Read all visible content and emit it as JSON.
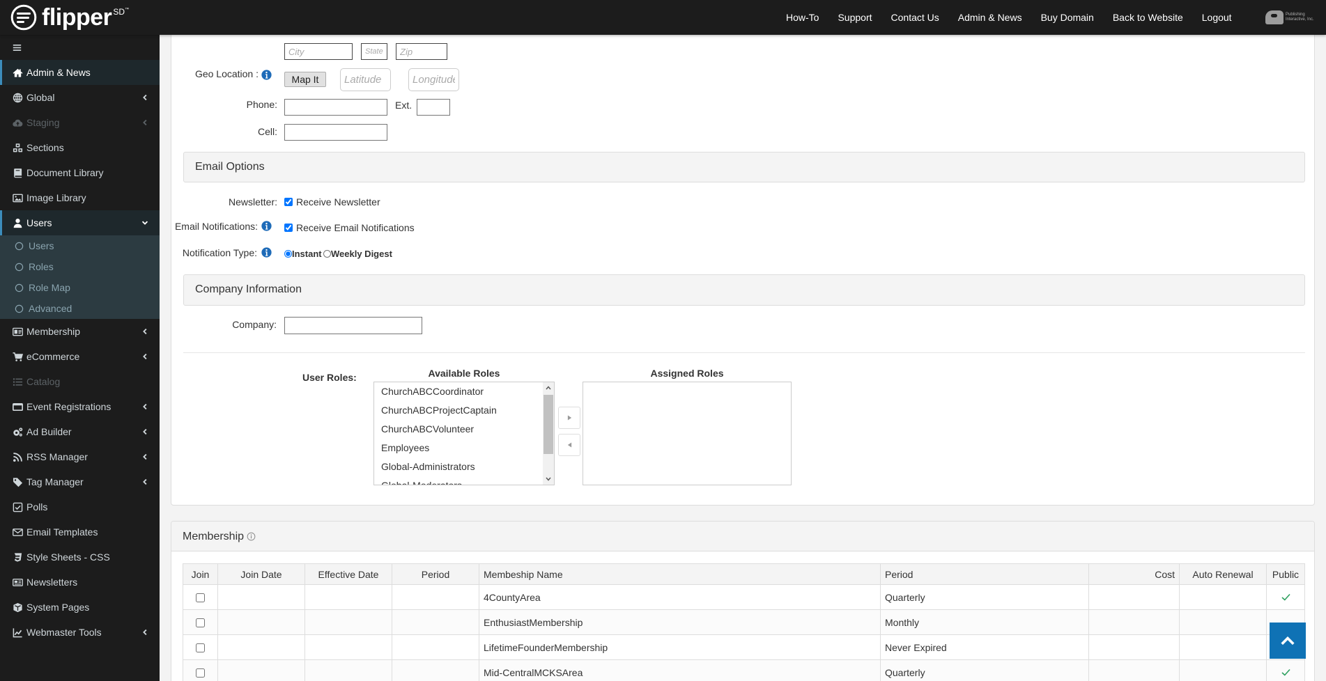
{
  "header": {
    "logo_text": "flipper",
    "logo_sup": "SD",
    "logo_tm": "™",
    "nav": [
      "How-To",
      "Support",
      "Contact Us",
      "Admin & News",
      "Buy Domain",
      "Back to Website",
      "Logout"
    ],
    "partner_logo_text": [
      "Publishing",
      "Interactive, Inc."
    ]
  },
  "sidebar": {
    "toggle_icon": "bars-icon",
    "items": [
      {
        "label": "Admin & News",
        "icon": "home-icon",
        "state": "active"
      },
      {
        "label": "Global",
        "icon": "globe-icon",
        "chevron": "left"
      },
      {
        "label": "Staging",
        "icon": "cloud-upload-icon",
        "chevron": "left",
        "state": "disabled"
      },
      {
        "label": "Sections",
        "icon": "cubes-icon"
      },
      {
        "label": "Document Library",
        "icon": "book-icon"
      },
      {
        "label": "Image Library",
        "icon": "image-icon"
      },
      {
        "label": "Users",
        "icon": "user-icon",
        "chevron": "down",
        "state": "open",
        "submenu": [
          {
            "label": "Users"
          },
          {
            "label": "Roles"
          },
          {
            "label": "Role Map"
          },
          {
            "label": "Advanced"
          }
        ]
      },
      {
        "label": "Membership",
        "icon": "id-card-icon",
        "chevron": "left"
      },
      {
        "label": "eCommerce",
        "icon": "cart-icon",
        "chevron": "left"
      },
      {
        "label": "Catalog",
        "icon": "list-icon",
        "state": "disabled"
      },
      {
        "label": "Event Registrations",
        "icon": "calendar-icon",
        "chevron": "left"
      },
      {
        "label": "Ad Builder",
        "icon": "cogs-icon",
        "chevron": "left"
      },
      {
        "label": "RSS Manager",
        "icon": "rss-icon",
        "chevron": "left"
      },
      {
        "label": "Tag Manager",
        "icon": "tag-icon",
        "chevron": "left"
      },
      {
        "label": "Polls",
        "icon": "check-square-icon"
      },
      {
        "label": "Email Templates",
        "icon": "envelope-icon"
      },
      {
        "label": "Style Sheets - CSS",
        "icon": "css3-icon"
      },
      {
        "label": "Newsletters",
        "icon": "newspaper-icon"
      },
      {
        "label": "System Pages",
        "icon": "cube-icon"
      },
      {
        "label": "Webmaster Tools",
        "icon": "line-chart-icon",
        "chevron": "left"
      }
    ]
  },
  "contact": {
    "city": {
      "value": "",
      "placeholder": "City"
    },
    "state": {
      "value": "",
      "placeholder": "State"
    },
    "zip": {
      "value": "",
      "placeholder": "Zip"
    },
    "geo_label": "Geo Location :",
    "map_button": "Map It",
    "latitude": {
      "value": "",
      "placeholder": "Latitude"
    },
    "longitude": {
      "value": "",
      "placeholder": "Longitude"
    },
    "phone_label": "Phone:",
    "phone": {
      "value": ""
    },
    "ext_label": "Ext.",
    "ext": {
      "value": ""
    },
    "cell_label": "Cell:",
    "cell": {
      "value": ""
    }
  },
  "email_options": {
    "title": "Email Options",
    "newsletter_label": "Newsletter:",
    "newsletter_option": {
      "label": "Receive Newsletter",
      "checked": true
    },
    "notifications_label": "Email Notifications:",
    "notifications_option": {
      "label": "Receive Email Notifications",
      "checked": true
    },
    "notification_type_label": "Notification Type:",
    "notification_types": [
      {
        "label": "Instant",
        "selected": true
      },
      {
        "label": "Weekly Digest",
        "selected": false
      }
    ]
  },
  "company": {
    "title": "Company Information",
    "label": "Company:",
    "value": ""
  },
  "roles": {
    "label": "User Roles:",
    "available_title": "Available Roles",
    "assigned_title": "Assigned Roles",
    "available": [
      "ChurchABCCoordinator",
      "ChurchABCProjectCaptain",
      "ChurchABCVolunteer",
      "Employees",
      "Global-Administrators",
      "Global-Moderators"
    ],
    "assigned": []
  },
  "membership": {
    "title": "Membership",
    "columns": [
      "Join",
      "Join Date",
      "Effective Date",
      "Period",
      "Membeship Name",
      "Period",
      "Cost",
      "Auto Renewal",
      "Public"
    ],
    "rows": [
      {
        "join": false,
        "join_date": "",
        "effective_date": "",
        "period": "",
        "name": "4CountyArea",
        "membership_period": "Quarterly",
        "cost": "",
        "auto_renewal": "",
        "public": true
      },
      {
        "join": false,
        "join_date": "",
        "effective_date": "",
        "period": "",
        "name": "EnthusiastMembership",
        "membership_period": "Monthly",
        "cost": "",
        "auto_renewal": "",
        "public": false
      },
      {
        "join": false,
        "join_date": "",
        "effective_date": "",
        "period": "",
        "name": "LifetimeFounderMembership",
        "membership_period": "Never Expired",
        "cost": "",
        "auto_renewal": "",
        "public": false
      },
      {
        "join": false,
        "join_date": "",
        "effective_date": "",
        "period": "",
        "name": "Mid-CentralMCKSArea",
        "membership_period": "Quarterly",
        "cost": "",
        "auto_renewal": "",
        "public": true
      }
    ]
  },
  "scroll_top": {
    "icon": "chevron-up-icon"
  },
  "colors": {
    "header_bg": "#1c1c1c",
    "sidebar_active_border": "#3c8dbc",
    "submenu_bg": "#2c3b41",
    "info_icon": "#1e6bb8",
    "scroll_top_bg": "#0f72b5",
    "public_check": "#2ea05f"
  }
}
